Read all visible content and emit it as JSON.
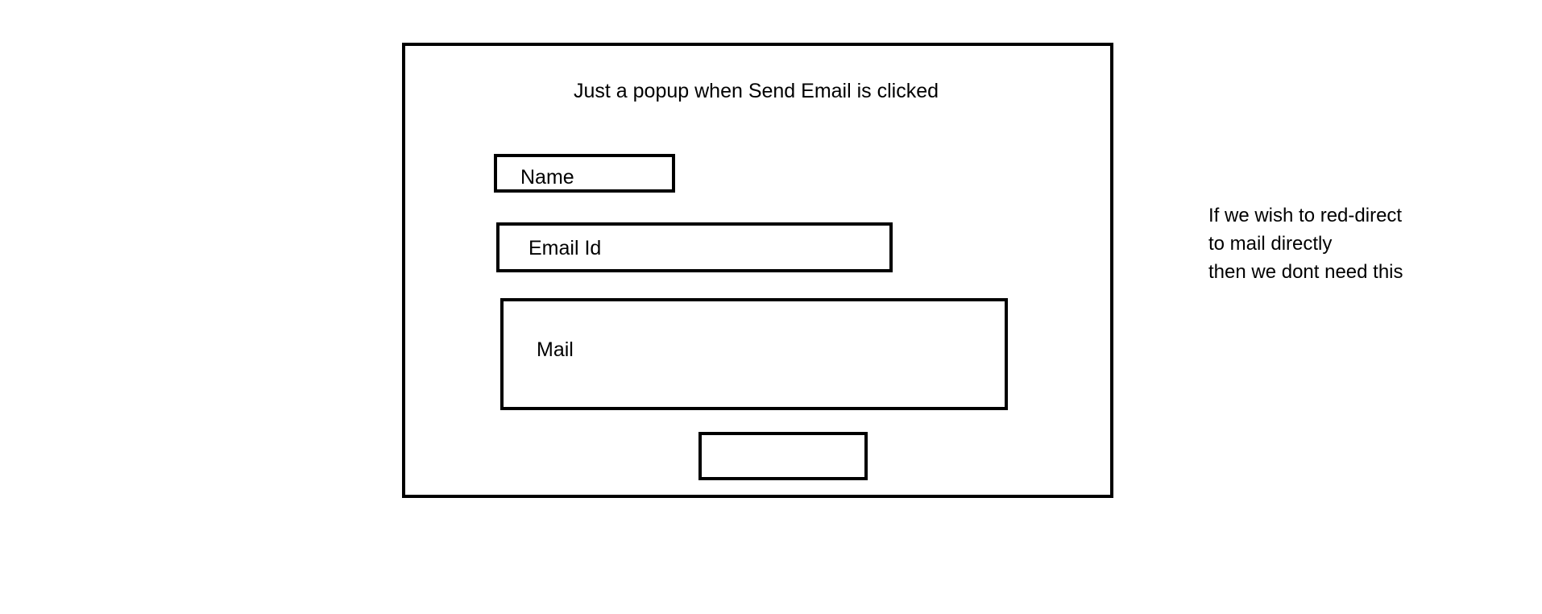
{
  "popup": {
    "title": "Just a popup when Send Email is clicked",
    "name_label": "Name",
    "email_label": "Email Id",
    "mail_label": "Mail",
    "send_button_label": ""
  },
  "note": {
    "lines": [
      "If we wish to red-direct",
      "to mail directly",
      "then we dont need this"
    ]
  }
}
